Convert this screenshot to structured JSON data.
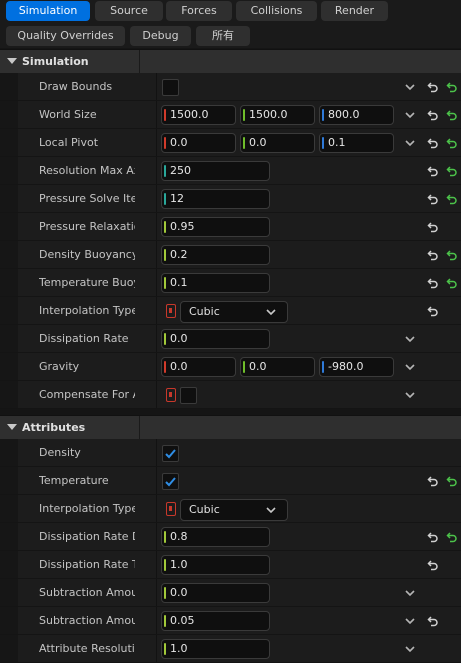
{
  "tabs": [
    "Simulation",
    "Source",
    "Forces",
    "Collisions",
    "Render",
    "Quality Overrides",
    "Debug",
    "所有"
  ],
  "active_tab": "Simulation",
  "sections": {
    "simulation": "Simulation",
    "attributes": "Attributes"
  },
  "rows": {
    "draw_bounds": {
      "label": "Draw Bounds"
    },
    "world_size": {
      "label": "World Size",
      "x": "1500.0",
      "y": "1500.0",
      "z": "800.0"
    },
    "local_pivot": {
      "label": "Local Pivot",
      "x": "0.0",
      "y": "0.0",
      "z": "0.1"
    },
    "resolution_max_axis": {
      "label": "Resolution Max Ax",
      "value": "250"
    },
    "pressure_solve_iterations": {
      "label": "Pressure Solve Iter",
      "value": "12"
    },
    "pressure_relaxation": {
      "label": "Pressure Relaxatio",
      "value": "0.95"
    },
    "density_buoyancy": {
      "label": "Density Buoyancy",
      "value": "0.2"
    },
    "temperature_buoyancy": {
      "label": "Temperature Buoya",
      "value": "0.1"
    },
    "interpolation_type": {
      "label": "Interpolation Type",
      "value": "Cubic"
    },
    "dissipation_rate": {
      "label": "Dissipation Rate",
      "value": "0.0"
    },
    "gravity": {
      "label": "Gravity",
      "x": "0.0",
      "y": "0.0",
      "z": "-980.0"
    },
    "compensate_for_ac": {
      "label": "Compensate For Ac"
    },
    "density": {
      "label": "Density",
      "checked": true
    },
    "temperature": {
      "label": "Temperature",
      "checked": true
    },
    "attr_interpolation_type": {
      "label": "Interpolation Type",
      "value": "Cubic"
    },
    "dissipation_rate_density": {
      "label": "Dissipation Rate De",
      "value": "0.8"
    },
    "dissipation_rate_temperature": {
      "label": "Dissipation Rate Te",
      "value": "1.0"
    },
    "subtraction_amount_1": {
      "label": "Subtraction Amour",
      "value": "0.0"
    },
    "subtraction_amount_2": {
      "label": "Subtraction Amour",
      "value": "0.05"
    },
    "attribute_resolution": {
      "label": "Attribute Resolutio",
      "value": "1.0"
    }
  },
  "colors": {
    "accent": "#0070e0",
    "check": "#2f8de4",
    "reset_green": "#4cc24a"
  }
}
